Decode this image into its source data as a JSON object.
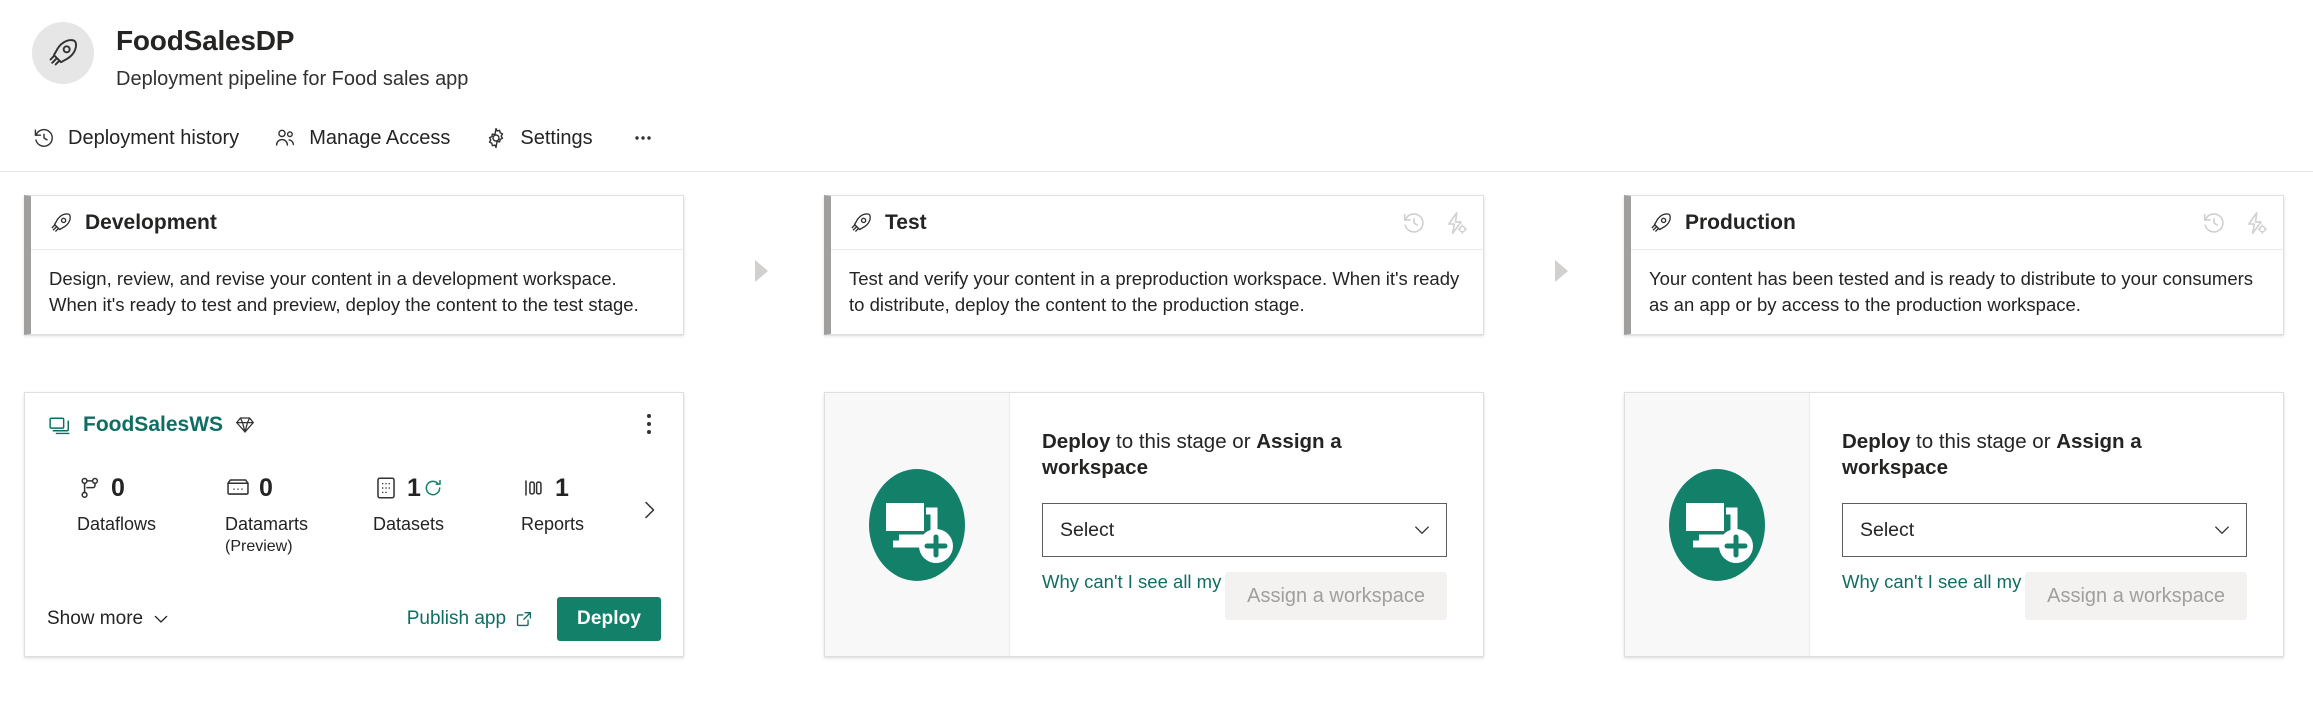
{
  "header": {
    "pipeline_icon": "rocket-icon",
    "title": "FoodSalesDP",
    "subtitle": "Deployment pipeline for Food sales app",
    "commands": [
      {
        "icon": "history-icon",
        "label": "Deployment history"
      },
      {
        "icon": "people-icon",
        "label": "Manage Access"
      },
      {
        "icon": "gear-icon",
        "label": "Settings"
      },
      {
        "icon": "ellipsis-icon",
        "label": "···"
      }
    ]
  },
  "colors": {
    "brand_teal": "#13806A",
    "link_teal": "#0F6E63",
    "stage_accent_bar": "#A19F9D",
    "card_border": "#E1DFDD",
    "disabled_text": "#A19F9D",
    "arrow_gray": "#D2D0CE"
  },
  "stages": [
    {
      "id": "development",
      "icon": "rocket-icon",
      "title": "Development",
      "description": "Design, review, and revise your content in a development workspace. When it's ready to test and preview, deploy the content to the test stage.",
      "head_actions": []
    },
    {
      "id": "test",
      "icon": "rocket-icon",
      "title": "Test",
      "description": "Test and verify your content in a preproduction workspace. When it's ready to distribute, deploy the content to the production stage.",
      "head_actions": [
        "history-icon",
        "deployment-rules-icon"
      ]
    },
    {
      "id": "production",
      "icon": "rocket-icon",
      "title": "Production",
      "description": "Your content has been tested and is ready to distribute to your consumers as an app or by access to the production workspace.",
      "head_actions": [
        "history-icon",
        "deployment-rules-icon"
      ]
    }
  ],
  "arrows": {
    "dev_to_test": "arrow-right-icon",
    "test_to_prod": "arrow-right-icon"
  },
  "development_content": {
    "workspace_icon": "workspace-stacked-icon",
    "workspace_name": "FoodSalesWS",
    "premium_badge": "premium-diamond-icon",
    "more_menu": "more-vertical-icon",
    "artifacts": [
      {
        "icon": "dataflow-icon",
        "count": "0",
        "name": "Dataflows",
        "sub": "",
        "refreshing": false
      },
      {
        "icon": "datamart-icon",
        "count": "0",
        "name": "Datamarts",
        "sub": "(Preview)",
        "refreshing": false
      },
      {
        "icon": "dataset-icon",
        "count": "1",
        "name": "Datasets",
        "sub": "",
        "refreshing": true
      },
      {
        "icon": "report-icon",
        "count": "1",
        "name": "Reports",
        "sub": "",
        "refreshing": false
      }
    ],
    "next_arrow": "chevron-right-icon",
    "show_more_label": "Show more",
    "show_more_chevron": "chevron-down-icon",
    "publish_app_label": "Publish app",
    "publish_app_icon": "open-in-new-icon",
    "deploy_label": "Deploy"
  },
  "empty_stages": {
    "test": {
      "illustration_icon": "add-workspace-illustration",
      "heading_lead": "Deploy",
      "heading_mid": " to this stage or ",
      "heading_tail": "Assign a workspace",
      "select_value": "Select",
      "select_placeholder": "Select",
      "select_chevron": "chevron-down-icon",
      "help_link": "Why can't I see all my workspaces?",
      "assign_label": "Assign a workspace"
    },
    "production": {
      "illustration_icon": "add-workspace-illustration",
      "heading_lead": "Deploy",
      "heading_mid": " to this stage or ",
      "heading_tail": "Assign a workspace",
      "select_value": "Select",
      "select_placeholder": "Select",
      "select_chevron": "chevron-down-icon",
      "help_link": "Why can't I see all my workspaces?",
      "assign_label": "Assign a workspace"
    }
  }
}
